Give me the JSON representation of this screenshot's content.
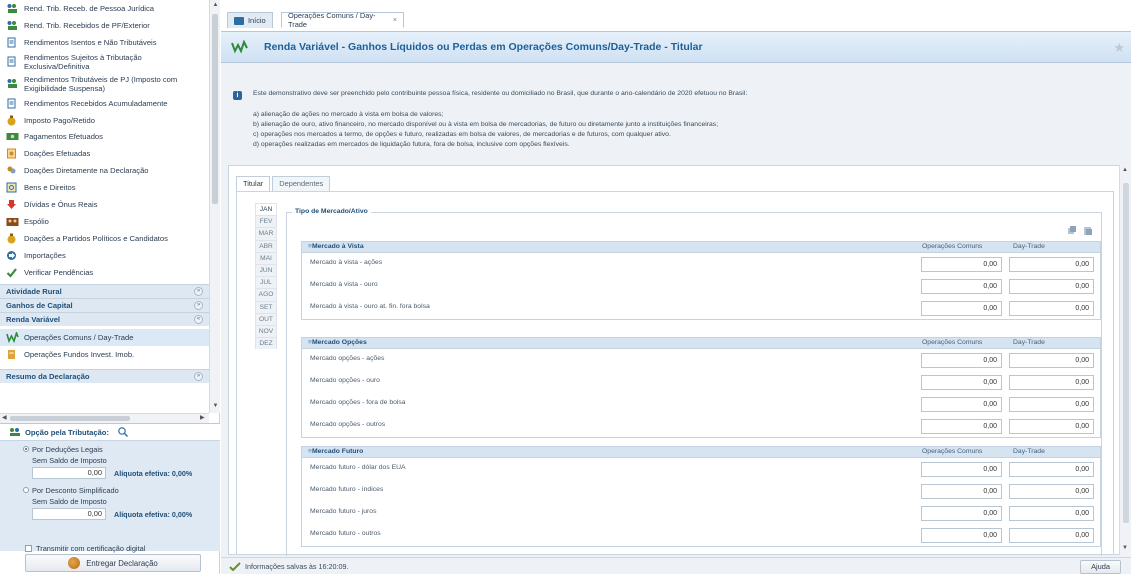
{
  "sidebar": {
    "items": [
      {
        "label": "Rend. Trib. Receb. de Pessoa Jurídica",
        "icon": "people-money-icon",
        "color": "#3b8a3e"
      },
      {
        "label": "Rend. Trib. Recebidos de PF/Exterior",
        "icon": "people-money-icon",
        "color": "#3b8a3e"
      },
      {
        "label": "Rendimentos Isentos e Não Tributáveis",
        "icon": "document-icon",
        "color": "#2d6ca5"
      },
      {
        "label": "Rendimentos Sujeitos à Tributação Exclusiva/Definitiva",
        "icon": "document-icon",
        "color": "#2d6ca5",
        "two_line": true
      },
      {
        "label": "Rendimentos Tributáveis de PJ (Imposto com Exigibilidade Suspensa)",
        "icon": "people-money-icon",
        "color": "#3b8a3e",
        "two_line": true
      },
      {
        "label": "Rendimentos Recebidos Acumuladamente",
        "icon": "document-icon",
        "color": "#2d6ca5"
      },
      {
        "label": "Imposto Pago/Retido",
        "icon": "money-bag-icon",
        "color": "#d9a21b"
      },
      {
        "label": "Pagamentos Efetuados",
        "icon": "money-bill-icon",
        "color": "#3b8a3e"
      },
      {
        "label": "Doações Efetuadas",
        "icon": "donation-icon",
        "color": "#d98a1b"
      },
      {
        "label": "Doações Diretamente na Declaração",
        "icon": "hand-coins-icon",
        "color": "#c78a1b"
      },
      {
        "label": "Bens e Direitos",
        "icon": "safe-icon",
        "color": "#2d6ca5"
      },
      {
        "label": "Dívidas e Ônus Reais",
        "icon": "arrow-down-icon",
        "color": "#d03a2b"
      },
      {
        "label": "Espólio",
        "icon": "people-group-icon",
        "color": "#8a4a1b"
      },
      {
        "label": "Doações a Partidos Políticos e Candidatos",
        "icon": "money-bag-icon",
        "color": "#d9a21b"
      },
      {
        "label": "Importações",
        "icon": "import-icon",
        "color": "#2d6ca5"
      },
      {
        "label": "Verificar Pendências",
        "icon": "checkmark-icon",
        "color": "#3b8a3e"
      }
    ],
    "sections": [
      {
        "label": "Atividade Rural",
        "toggle": "»"
      },
      {
        "label": "Ganhos de Capital",
        "toggle": "»"
      },
      {
        "label": "Renda Variável",
        "toggle": "«"
      }
    ],
    "renda_items": [
      {
        "label": "Operações Comuns / Day-Trade",
        "active": true
      },
      {
        "label": "Operações Fundos Invest. Imob."
      }
    ],
    "cut_section": "Resumo da Declaração"
  },
  "tax_option": {
    "title": "Opção pela Tributação:",
    "deducoes_label": "Por Deduções Legais",
    "deducoes_sub": "Sem Saldo de Imposto",
    "deducoes_value": "0,00",
    "deducoes_aliquota": "Alíquota efetiva: 0,00%",
    "simplificado_label": "Por Desconto Simplificado",
    "simplificado_sub": "Sem Saldo de Imposto",
    "simplificado_value": "0,00",
    "simplificado_aliquota": "Alíquota efetiva: 0,00%",
    "transmit_label": "Transmitir com certificação digital",
    "deliver_label": "Entregar Declaração"
  },
  "tabs": {
    "home": "Início",
    "ops": "Operações Comuns / Day-Trade",
    "close": "×"
  },
  "page_title": "Renda Variável - Ganhos Líquidos ou Perdas em Operações Comuns/Day-Trade - Titular",
  "info": {
    "intro": "Este demonstrativo deve ser preenchido pelo contribuinte pessoa física, residente ou domiciliado no Brasil, que durante o ano-calendário de 2020 efetuou no Brasil:",
    "items": [
      "a) alienação de ações no mercado à vista em bolsa de valores;",
      "b) alienação de ouro, ativo financeiro, no mercado disponível ou à vista em bolsa de mercadorias, de futuro ou diretamente junto a instituições financeiras;",
      "c) operações nos mercados a termo, de opções e futuro, realizadas em bolsa de valores, de mercadorias e de futuros, com qualquer ativo.",
      "d) operações realizadas em mercados de liquidação futura, fora de bolsa, inclusive com opções flexíveis."
    ]
  },
  "subtabs": [
    "Titular",
    "Dependentes"
  ],
  "months": [
    "JAN",
    "FEV",
    "MAR",
    "ABR",
    "MAI",
    "JUN",
    "JUL",
    "AGO",
    "SET",
    "OUT",
    "NOV",
    "DEZ"
  ],
  "fieldset_legend": "Tipo de Mercado/Ativo",
  "col_comuns": "Operações Comuns",
  "col_daytrade": "Day-Trade",
  "groups": [
    {
      "title": "Mercado à Vista",
      "rows": [
        {
          "label": "Mercado à vista - ações",
          "comuns": "0,00",
          "daytrade": "0,00"
        },
        {
          "label": "Mercado à vista - ouro",
          "comuns": "0,00",
          "daytrade": "0,00"
        },
        {
          "label": "Mercado à vista - ouro at. fin. fora bolsa",
          "comuns": "0,00",
          "daytrade": "0,00"
        }
      ]
    },
    {
      "title": "Mercado Opções",
      "rows": [
        {
          "label": "Mercado opções - ações",
          "comuns": "0,00",
          "daytrade": "0,00"
        },
        {
          "label": "Mercado opções - ouro",
          "comuns": "0,00",
          "daytrade": "0,00"
        },
        {
          "label": "Mercado opções - fora de bolsa",
          "comuns": "0,00",
          "daytrade": "0,00"
        },
        {
          "label": "Mercado opções - outros",
          "comuns": "0,00",
          "daytrade": "0,00"
        }
      ]
    },
    {
      "title": "Mercado Futuro",
      "rows": [
        {
          "label": "Mercado futuro - dólar dos EUA",
          "comuns": "0,00",
          "daytrade": "0,00"
        },
        {
          "label": "Mercado futuro - índices",
          "comuns": "0,00",
          "daytrade": "0,00"
        },
        {
          "label": "Mercado futuro - juros",
          "comuns": "0,00",
          "daytrade": "0,00"
        },
        {
          "label": "Mercado futuro - outros",
          "comuns": "0,00",
          "daytrade": "0,00"
        }
      ]
    }
  ],
  "status": "Informações salvas às 16:20:09.",
  "help_label": "Ajuda"
}
